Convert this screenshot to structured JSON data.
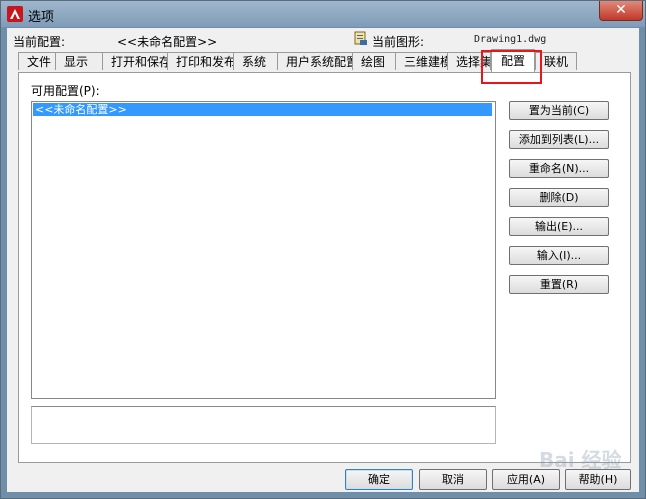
{
  "window": {
    "title": "选项",
    "close_label": "✕"
  },
  "header": {
    "current_profile_label": "当前配置:",
    "current_profile_value": "<<未命名配置>>",
    "current_drawing_label": "当前图形:",
    "current_drawing_value": "Drawing1.dwg"
  },
  "tabs": [
    {
      "label": "文件"
    },
    {
      "label": "显示"
    },
    {
      "label": "打开和保存"
    },
    {
      "label": "打印和发布"
    },
    {
      "label": "系统"
    },
    {
      "label": "用户系统配置"
    },
    {
      "label": "绘图"
    },
    {
      "label": "三维建模"
    },
    {
      "label": "选择集"
    },
    {
      "label": "配置"
    },
    {
      "label": "联机"
    }
  ],
  "active_tab": "配置",
  "profiles": {
    "label": "可用配置(P):",
    "items": [
      "<<未命名配置>>"
    ]
  },
  "side_buttons": {
    "set_current": "置为当前(C)",
    "add_to_list": "添加到列表(L)...",
    "rename": "重命名(N)...",
    "delete": "删除(D)",
    "export": "输出(E)...",
    "import": "输入(I)...",
    "reset": "重置(R)"
  },
  "bottom_buttons": {
    "ok": "确定",
    "cancel": "取消",
    "apply": "应用(A)",
    "help": "帮助(H)"
  },
  "watermark": {
    "text": "Bai 经验"
  },
  "colors": {
    "selection": "#3399ff",
    "highlight_box": "#e8151b",
    "close_button": "#c0392b",
    "app_icon": "#c8161d"
  },
  "icons": {
    "app": "autocad-logo-icon",
    "drawing": "drawing-file-icon",
    "close": "close-icon"
  }
}
